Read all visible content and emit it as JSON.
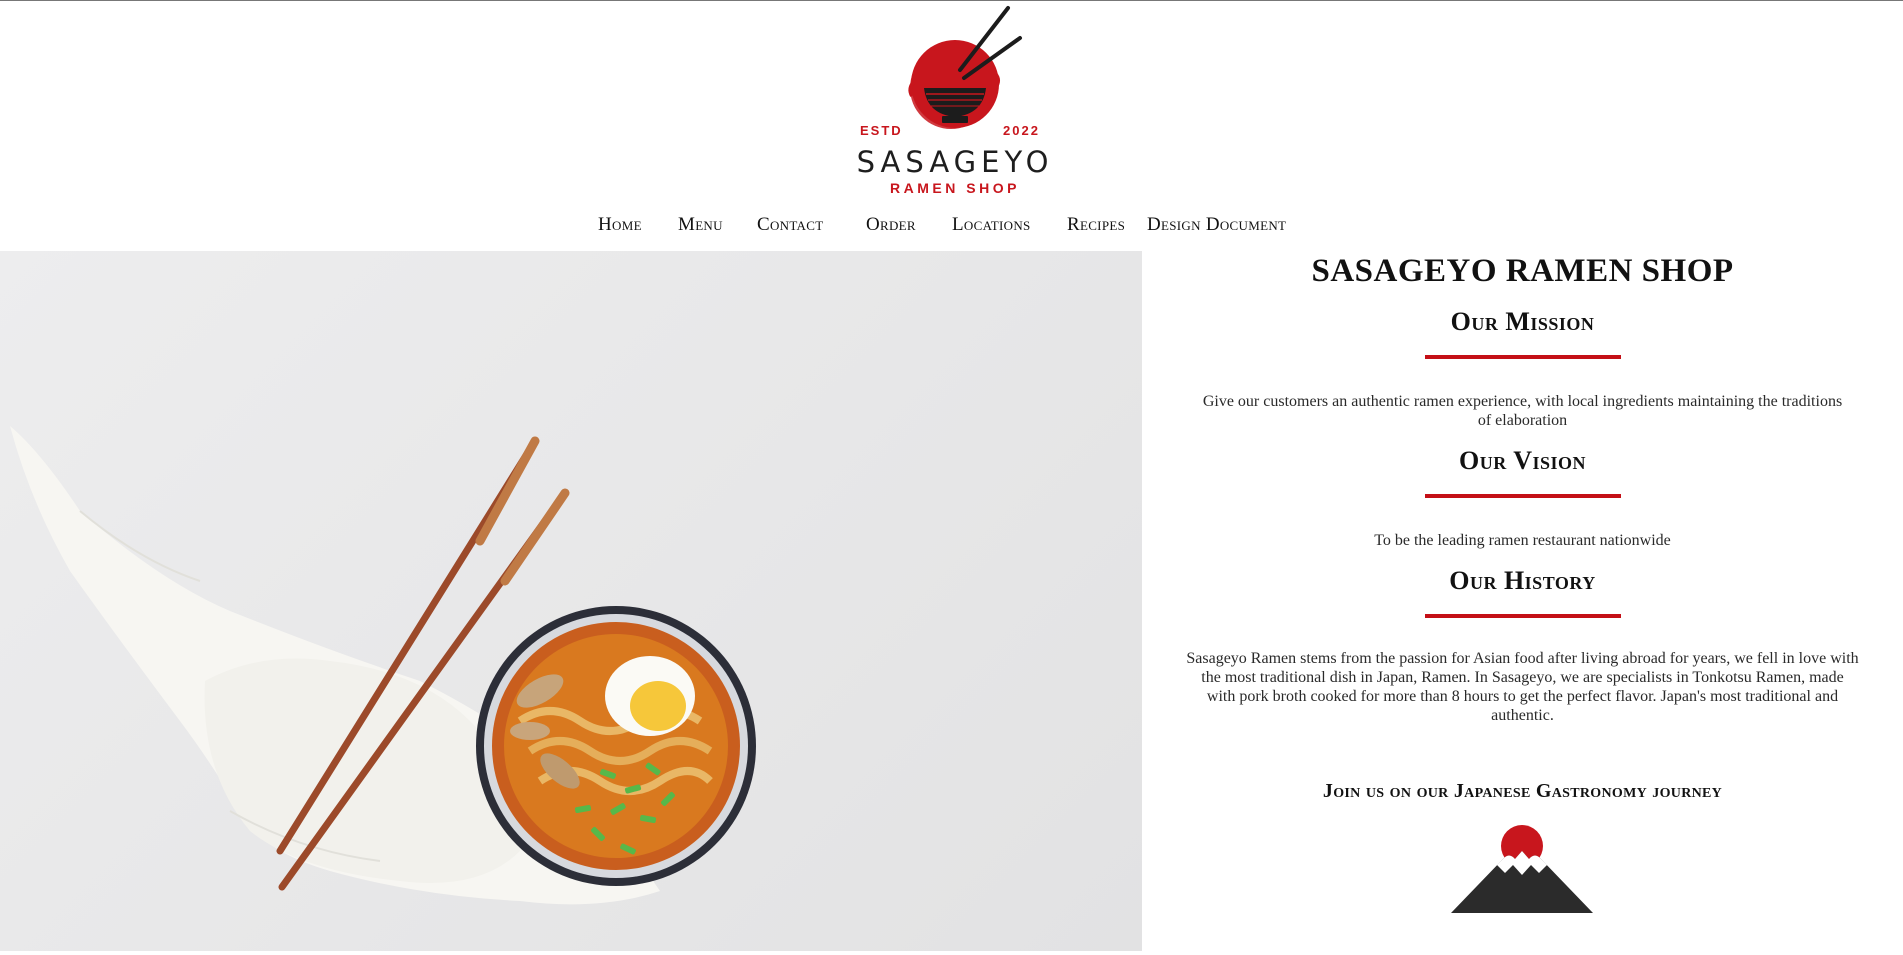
{
  "logo": {
    "estd": "ESTD",
    "year": "2022",
    "name": "SASAGEYO",
    "subtitle": "RAMEN SHOP"
  },
  "nav": {
    "items": [
      {
        "label": "Home"
      },
      {
        "label": "Menu"
      },
      {
        "label": "Contact"
      },
      {
        "label": "Order"
      },
      {
        "label": "Locations"
      },
      {
        "label": "Recipes"
      },
      {
        "label": "Design Document"
      }
    ]
  },
  "main": {
    "shop_title": "SASAGEYO RAMEN SHOP",
    "mission": {
      "heading": "Our Mission",
      "text": "Give our customers an authentic ramen experience, with local ingredients maintaining the traditions of elaboration"
    },
    "vision": {
      "heading": "Our Vision",
      "text": "To be the leading ramen restaurant nationwide"
    },
    "history": {
      "heading": "Our History",
      "text": "Sasageyo Ramen stems from the passion for Asian food after living abroad for years, we fell in love with the most traditional dish in Japan, Ramen. In Sasageyo, we are specialists in Tonkotsu Ramen, made with pork broth cooked for more than 8 hours to get the perfect flavor. Japan's most traditional and authentic."
    },
    "join_text": "Join us on our Japanese Gastronomy journey"
  },
  "colors": {
    "accent_red": "#c40f16",
    "text_dark": "#111111",
    "background": "#ffffff"
  },
  "icons": [
    "ramen-bowl-logo-icon",
    "mount-fuji-icon"
  ]
}
